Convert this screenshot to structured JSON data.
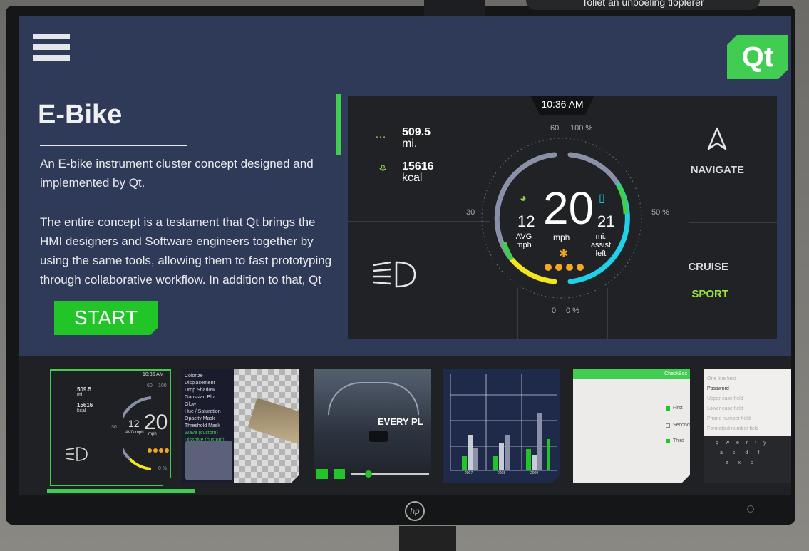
{
  "overlay": {
    "text": "Toliet an unboeling tloplerer"
  },
  "app": {
    "brand": "Qt",
    "title": "E-Bike",
    "description": [
      "An E-bike instrument cluster concept designed and implemented by Qt.",
      "The entire concept is a testament that Qt brings the HMI designers and Software engineers together by using the same tools, allowing them to fast prototyping through collaborative workflow. In addition to that, Qt"
    ],
    "start_label": "START"
  },
  "cluster": {
    "time": "10:36 AM",
    "distance": {
      "value": "509.5",
      "unit": "mi."
    },
    "calories": {
      "value": "15616",
      "unit": "kcal"
    },
    "speed": {
      "value": "20",
      "unit": "mph"
    },
    "avg_speed": {
      "value": "12",
      "label_1": "AVG",
      "label_2": "mph"
    },
    "assist": {
      "value": "21",
      "label_1": "mi.",
      "label_2": "assist",
      "label_3": "left"
    },
    "scale_labels": {
      "top_speed": "60",
      "top_battery": "100 %",
      "left": "30",
      "right": "50 %",
      "bottom_speed": "0",
      "bottom_battery": "0 %"
    },
    "navigate_label": "NAVIGATE",
    "modes": [
      {
        "label": "CRUISE",
        "active": false
      },
      {
        "label": "SPORT",
        "active": true
      }
    ],
    "colors": {
      "accent": "#41cd52",
      "sport": "#9be53a",
      "gauge_cyan": "#1fd0e6",
      "gauge_yellow": "#f2e71a"
    },
    "level_dots": 4
  },
  "thumbnails": {
    "ebike": {
      "time": "10:36 AM",
      "dist": "509.5",
      "dist_unit": "mi.",
      "cal": "15616",
      "cal_unit": "kcal",
      "speed": "20",
      "avg": "12",
      "avg_unit": "AVG mph",
      "speed_unit": "mph",
      "s60": "60",
      "s100": "100",
      "s30": "30",
      "s0": "0",
      "s0p": "0 %"
    },
    "effects": {
      "items": [
        "Colorize",
        "Displacement",
        "Drop Shadow",
        "Gaussian Blur",
        "Glow",
        "Hue / Saturation",
        "Opacity Mask",
        "Threshold Mask",
        "Wave (custom)",
        "Dissolve (custom)"
      ],
      "highlighted": [
        "Wave (custom)",
        "Dissolve (custom)"
      ]
    },
    "video": {
      "caption": "EVERY PL"
    },
    "bar_chart": {
      "x_labels": [
        "2007",
        "2008",
        "2009"
      ]
    },
    "checkbox": {
      "title": "CheckBox",
      "rows": [
        "First",
        "Second",
        "Third"
      ]
    },
    "keyboard": {
      "fields": [
        "One line field",
        "Password",
        "Upper case field",
        "Lower case field",
        "Phone number field",
        "Formatted number field"
      ],
      "keys_row1": [
        "q",
        "w",
        "e",
        "r",
        "t",
        "y"
      ],
      "keys_row2": [
        "a",
        "s",
        "d",
        "f"
      ],
      "keys_row3": [
        "z",
        "x",
        "c"
      ]
    }
  }
}
